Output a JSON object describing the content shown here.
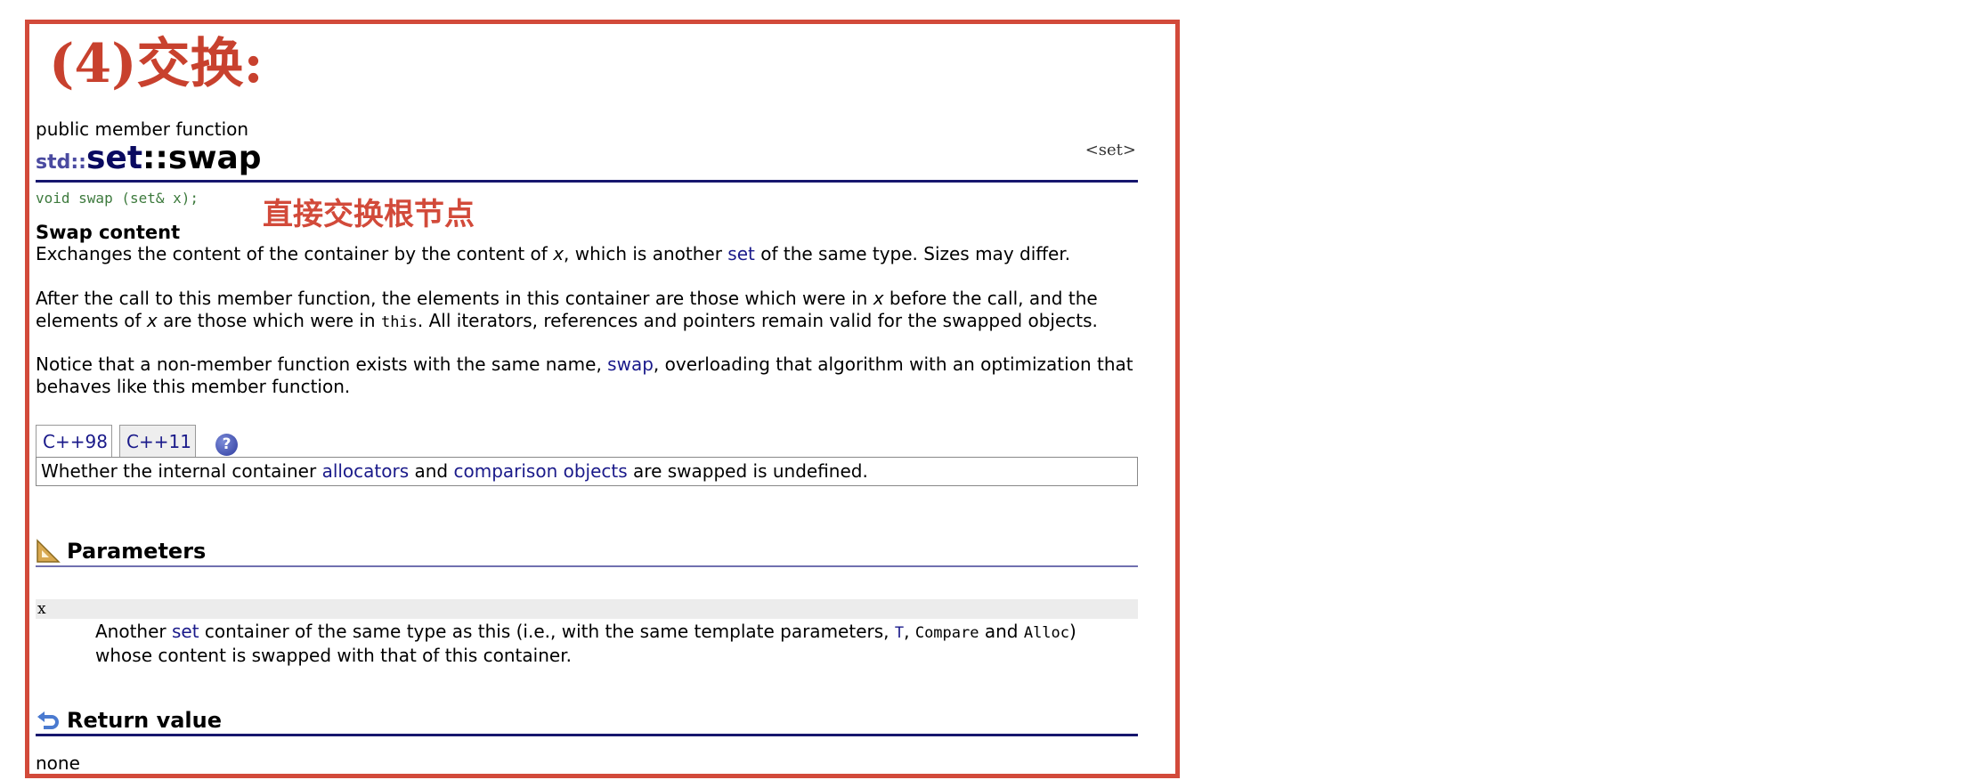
{
  "heading": "(4)交换:",
  "member_kind": "public member function",
  "header_tag": "<set>",
  "title": {
    "ns": "std::",
    "cls": "set",
    "sep": "::",
    "fn": "swap"
  },
  "prototype": "void swap (set& x);",
  "note_cn": "直接交换根节点",
  "section_title": "Swap content",
  "p1": {
    "a": "Exchanges the content of the container by the content of ",
    "x": "x",
    "b": ", which is another ",
    "link": "set",
    "c": " of the same type. Sizes may differ."
  },
  "p2": {
    "a": "After the call to this member function, the elements in this container are those which were in ",
    "x1": "x",
    "b": " before the call, and the elements of ",
    "x2": "x",
    "c": " are those which were in ",
    "code": "this",
    "d": ". All iterators, references and pointers remain valid for the swapped objects."
  },
  "p3": {
    "a": "Notice that a non-member function exists with the same name, ",
    "link": "swap",
    "b": ", overloading that algorithm with an optimization that behaves like this member function."
  },
  "tabs": [
    {
      "label": "C++98"
    },
    {
      "label": "C++11"
    }
  ],
  "help_glyph": "?",
  "tab_content": {
    "a": "Whether the internal container ",
    "link1": "allocators",
    "b": " and ",
    "link2": "comparison objects",
    "c": " are swapped is undefined."
  },
  "parameters": {
    "title": "Parameters",
    "name": "x",
    "desc": {
      "a": "Another ",
      "link": "set",
      "b": " container of the same type as this (i.e., with the same template parameters, ",
      "c1": "T",
      "s1": ", ",
      "c2": "Compare",
      "s2": " and ",
      "c3": "Alloc",
      "d": ") whose content is swapped with that of this container."
    }
  },
  "return_value": {
    "title": "Return value",
    "text": "none"
  }
}
